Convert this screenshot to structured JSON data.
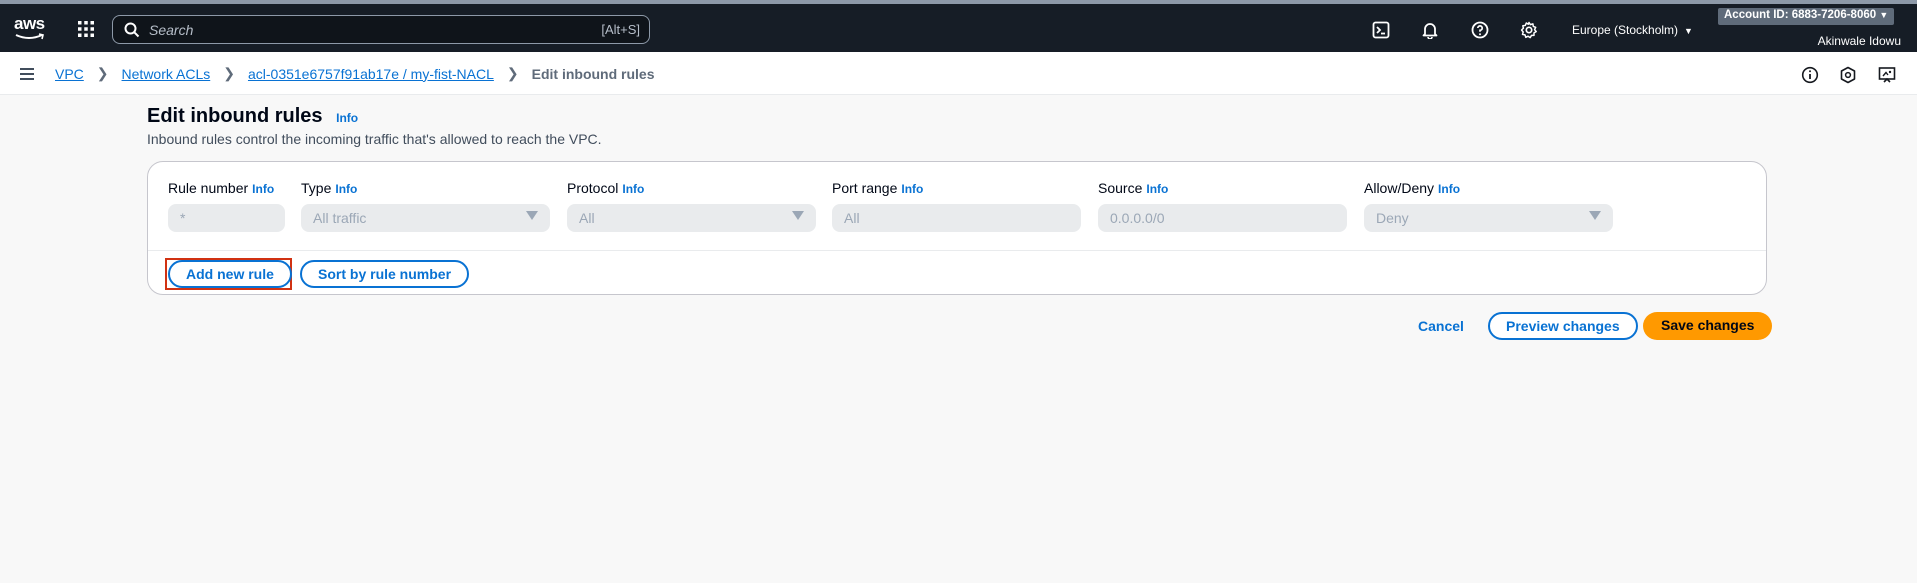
{
  "topnav": {
    "logo_text": "aws",
    "search_placeholder": "Search",
    "search_shortcut": "[Alt+S]",
    "region": "Europe (Stockholm)",
    "account_id": "Account ID: 6883-7206-8060",
    "username": "Akinwale Idowu"
  },
  "breadcrumb": {
    "items": [
      "VPC",
      "Network ACLs",
      "acl-0351e6757f91ab17e / my-fist-NACL"
    ],
    "current": "Edit inbound rules"
  },
  "page": {
    "title": "Edit inbound rules",
    "info": "Info",
    "description": "Inbound rules control the incoming traffic that's allowed to reach the VPC."
  },
  "rules_table": {
    "columns": [
      {
        "label": "Rule number",
        "info": "Info",
        "value": "*"
      },
      {
        "label": "Type",
        "info": "Info",
        "value": "All traffic"
      },
      {
        "label": "Protocol",
        "info": "Info",
        "value": "All"
      },
      {
        "label": "Port range",
        "info": "Info",
        "value": "All"
      },
      {
        "label": "Source",
        "info": "Info",
        "value": "0.0.0.0/0"
      },
      {
        "label": "Allow/Deny",
        "info": "Info",
        "value": "Deny"
      }
    ],
    "add_rule_label": "Add new rule",
    "sort_label": "Sort by rule number"
  },
  "actions": {
    "cancel": "Cancel",
    "preview": "Preview changes",
    "save": "Save changes"
  },
  "colors": {
    "nav_bg": "#161d26",
    "link": "#0972d3",
    "primary": "#ff9900",
    "highlight": "#d13212"
  }
}
